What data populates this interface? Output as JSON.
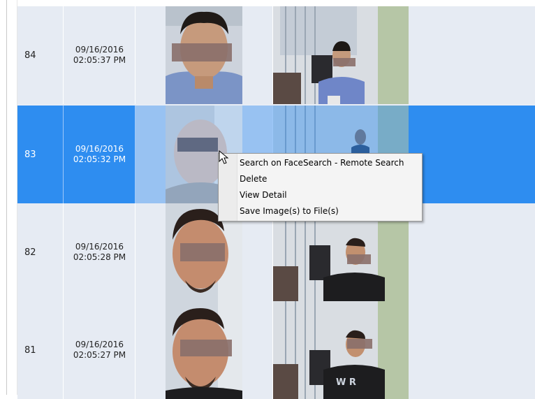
{
  "rows": [
    {
      "id": "84",
      "date": "09/16/2016",
      "time": "02:05:37 PM",
      "selected": false
    },
    {
      "id": "83",
      "date": "09/16/2016",
      "time": "02:05:32 PM",
      "selected": true
    },
    {
      "id": "82",
      "date": "09/16/2016",
      "time": "02:05:28 PM",
      "selected": false
    },
    {
      "id": "81",
      "date": "09/16/2016",
      "time": "02:05:27 PM",
      "selected": false
    }
  ],
  "context_menu": {
    "items": [
      "Search on FaceSearch - Remote Search",
      "Delete",
      "View Detail",
      "Save Image(s) to File(s)"
    ]
  },
  "colors": {
    "selection": "#2e8df0",
    "row_bg": "#e6ebf3"
  }
}
